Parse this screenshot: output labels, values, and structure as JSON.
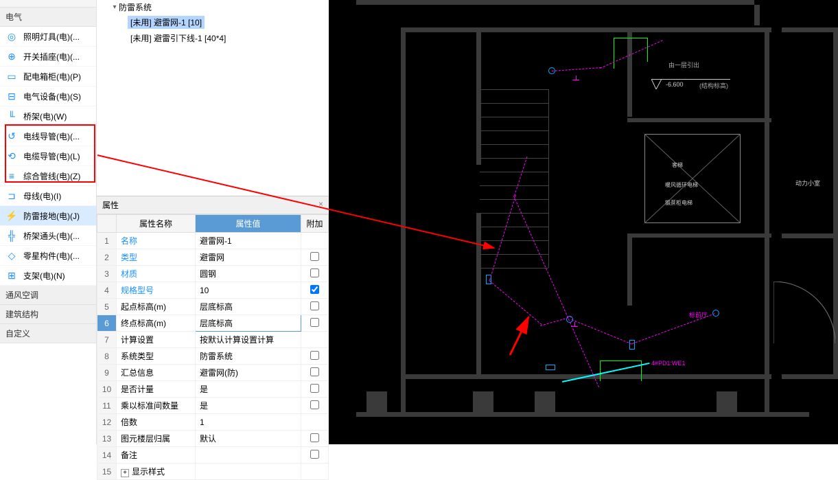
{
  "sidebar": {
    "section1": "电气",
    "items": [
      {
        "label": "照明灯具(电)(...",
        "icon": "bulb"
      },
      {
        "label": "开关插座(电)(...",
        "icon": "switch"
      },
      {
        "label": "配电箱柜(电)(P)",
        "icon": "panel"
      },
      {
        "label": "电气设备(电)(S)",
        "icon": "device"
      },
      {
        "label": "桥架(电)(W)",
        "icon": "tray"
      },
      {
        "label": "电线导管(电)(...",
        "icon": "conduit"
      },
      {
        "label": "电缆导管(电)(L)",
        "icon": "conduit2"
      },
      {
        "label": "综合管线(电)(Z)",
        "icon": "composite"
      },
      {
        "label": "母线(电)(I)",
        "icon": "busbar"
      },
      {
        "label": "防雷接地(电)(J)",
        "icon": "ground",
        "active": true
      },
      {
        "label": "桥架通头(电)(...",
        "icon": "fitting"
      },
      {
        "label": "零星构件(电)(...",
        "icon": "misc"
      },
      {
        "label": "支架(电)(N)",
        "icon": "support"
      }
    ],
    "section2": "通风空调",
    "section3": "建筑结构",
    "section4": "自定义"
  },
  "tree": {
    "root": "防雷系统",
    "children": [
      {
        "label": "[未用] 避雷网-1 [10]",
        "selected": true
      },
      {
        "label": "[未用] 避雷引下线-1 [40*4]"
      }
    ]
  },
  "properties": {
    "title": "属性",
    "headers": {
      "name": "属性名称",
      "value": "属性值",
      "attach": "附加"
    },
    "rows": [
      {
        "n": "1",
        "name": "名称",
        "value": "避雷网-1",
        "link": true
      },
      {
        "n": "2",
        "name": "类型",
        "value": "避雷网",
        "link": true,
        "cb": false
      },
      {
        "n": "3",
        "name": "材质",
        "value": "圆钢",
        "link": true,
        "cb": false
      },
      {
        "n": "4",
        "name": "规格型号",
        "value": "10",
        "link": true,
        "cb": true
      },
      {
        "n": "5",
        "name": "起点标高(m)",
        "value": "层底标高",
        "cb": false
      },
      {
        "n": "6",
        "name": "终点标高(m)",
        "value": "层底标高",
        "selected": true,
        "cb": false
      },
      {
        "n": "7",
        "name": "计算设置",
        "value": "按默认计算设置计算"
      },
      {
        "n": "8",
        "name": "系统类型",
        "value": "防雷系统",
        "cb": false
      },
      {
        "n": "9",
        "name": "汇总信息",
        "value": "避雷网(防)",
        "cb": false
      },
      {
        "n": "10",
        "name": "是否计量",
        "value": "是",
        "cb": false
      },
      {
        "n": "11",
        "name": "乘以标准间数量",
        "value": "是",
        "cb": false
      },
      {
        "n": "12",
        "name": "倍数",
        "value": "1"
      },
      {
        "n": "13",
        "name": "图元楼层归属",
        "value": "默认",
        "cb": false
      },
      {
        "n": "14",
        "name": "备注",
        "value": "",
        "cb": false
      },
      {
        "n": "15",
        "name": "显示样式",
        "value": "",
        "expand": true
      }
    ]
  },
  "cad": {
    "elevation": "-6.600",
    "annotation1": "由一层引出",
    "annotation2": "(结构标高)",
    "room1": "客梯",
    "room2": "暖风循环电梯",
    "room3": "锻蔗柜电梯",
    "room4": "动力小室",
    "label1": "标前厅",
    "label2": "4#PD1:WE1"
  }
}
